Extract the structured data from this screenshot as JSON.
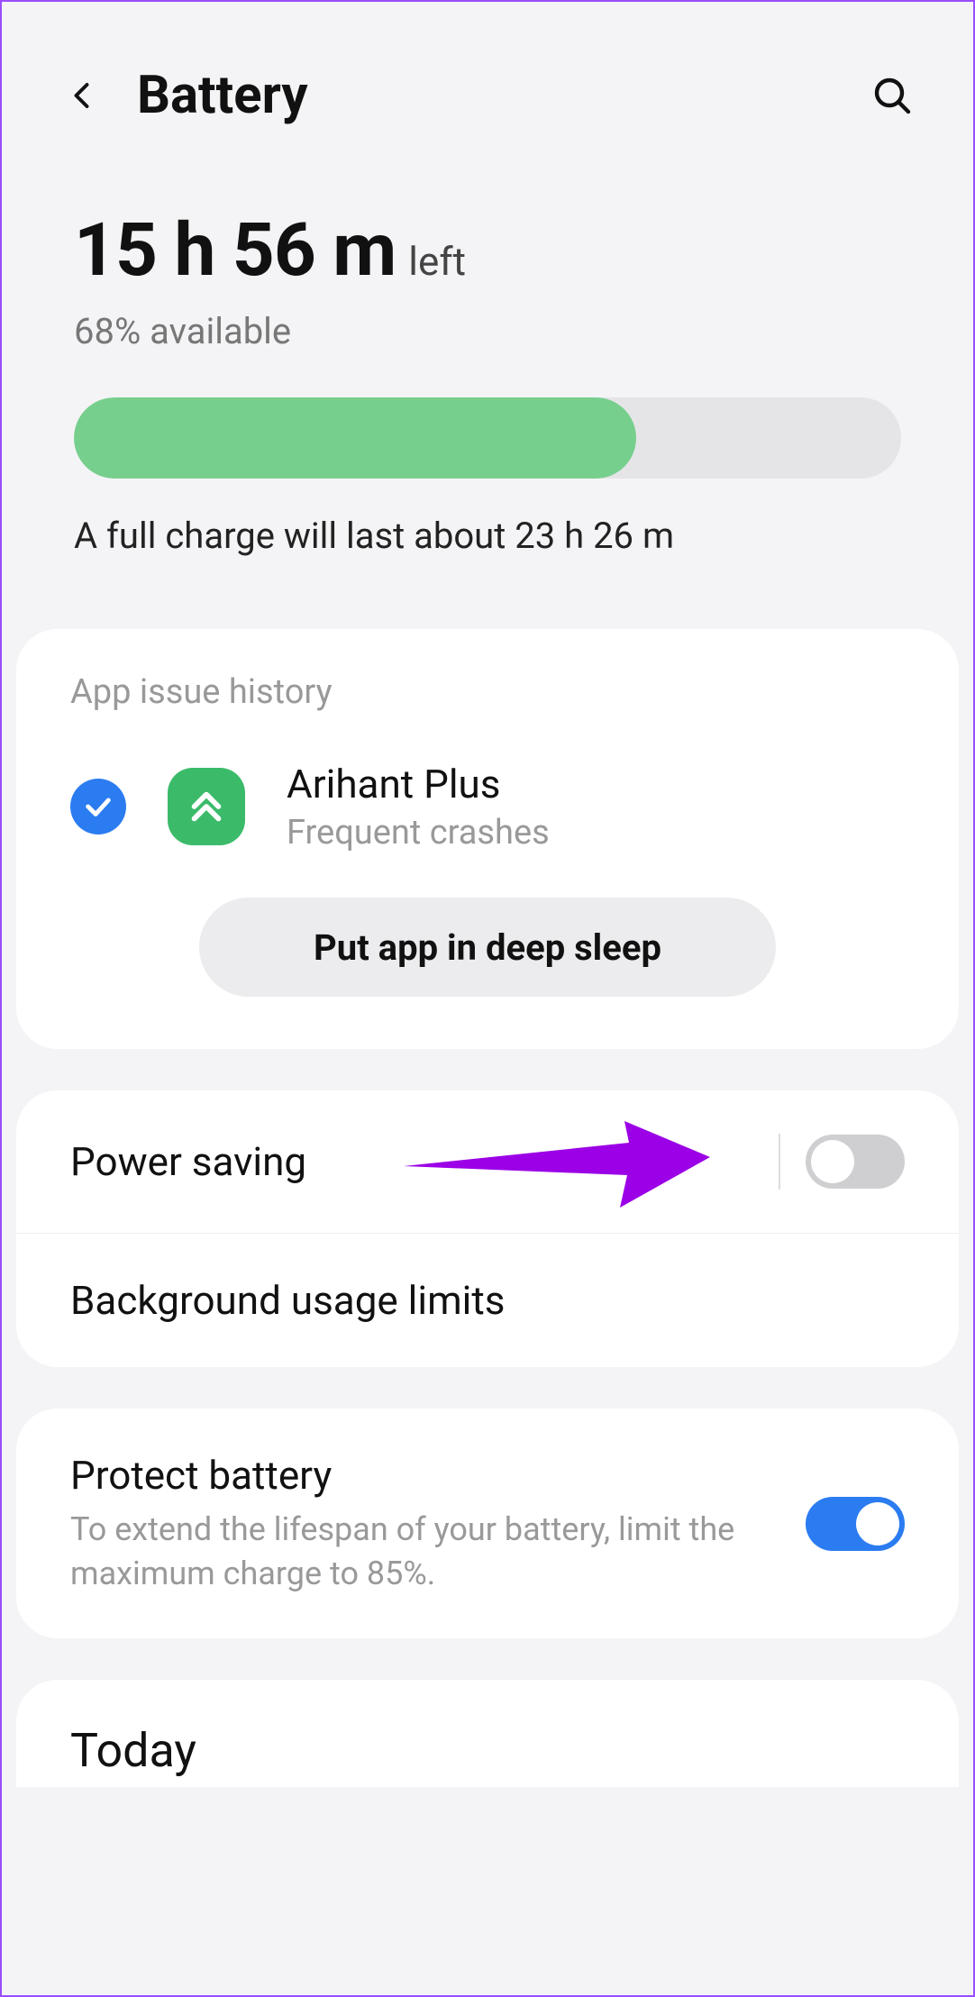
{
  "header": {
    "title": "Battery"
  },
  "stats": {
    "time_remaining": "15 h 56 m",
    "time_suffix": "left",
    "percent_line": "68% available",
    "percent_value": 68,
    "full_charge_line": "A full charge will last about 23 h 26 m"
  },
  "issue": {
    "section_label": "App issue history",
    "app_name": "Arihant Plus",
    "app_detail": "Frequent crashes",
    "action_button": "Put app in deep sleep"
  },
  "settings": {
    "power_saving": {
      "title": "Power saving",
      "enabled": false
    },
    "background_limits": {
      "title": "Background usage limits"
    },
    "protect_battery": {
      "title": "Protect battery",
      "description": "To extend the lifespan of your battery, limit the maximum charge to 85%.",
      "enabled": true
    }
  },
  "today": {
    "title": "Today"
  },
  "colors": {
    "accent_blue": "#2b7cf0",
    "progress_green": "#77cf8d",
    "annotation_purple": "#9b00e6"
  }
}
